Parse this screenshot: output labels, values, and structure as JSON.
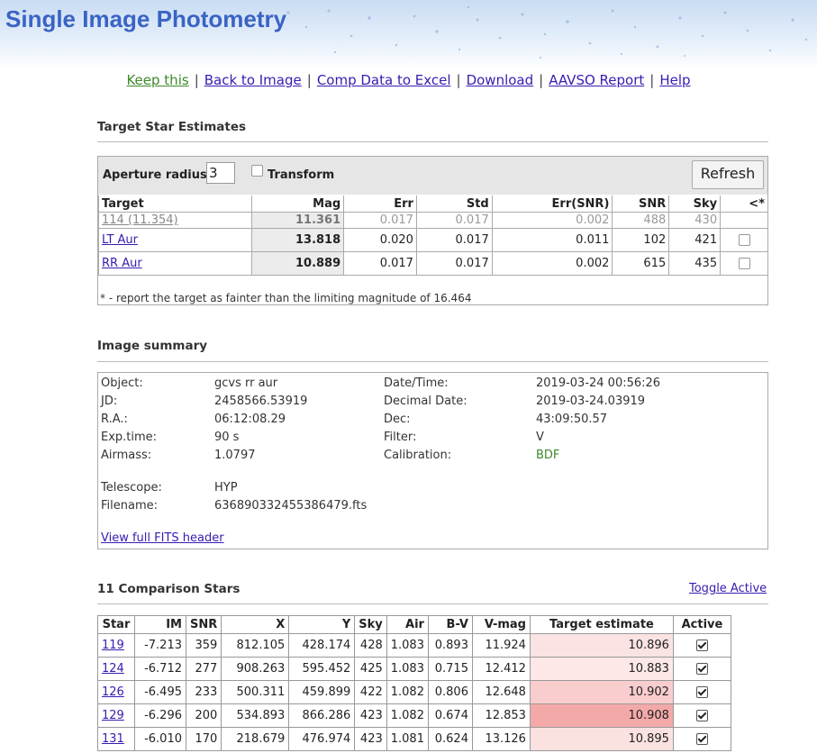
{
  "app": {
    "title": "Single Image Photometry"
  },
  "nav": [
    {
      "label": "Keep this"
    },
    {
      "label": "Back to Image"
    },
    {
      "label": "Comp Data to Excel"
    },
    {
      "label": "Download"
    },
    {
      "label": "AAVSO Report"
    },
    {
      "label": "Help"
    }
  ],
  "target_section": {
    "title": "Target Star Estimates",
    "aperture_label": "Aperture radius:",
    "aperture_value": "3",
    "transform_label": "Transform",
    "transform_checked": false,
    "refresh_label": "Refresh",
    "columns": [
      "Target",
      "Mag",
      "Err",
      "Std",
      "Err(SNR)",
      "SNR",
      "Sky",
      "<*"
    ],
    "rows": [
      {
        "target": "114 (11.354)",
        "mag": "11.361",
        "err": "0.017",
        "std": "0.017",
        "err_snr": "0.002",
        "snr": "488",
        "sky": "430"
      },
      {
        "target": "LT Aur",
        "mag": "13.818",
        "err": "0.020",
        "std": "0.017",
        "err_snr": "0.011",
        "snr": "102",
        "sky": "421"
      },
      {
        "target": "RR Aur",
        "mag": "10.889",
        "err": "0.017",
        "std": "0.017",
        "err_snr": "0.002",
        "snr": "615",
        "sky": "435"
      }
    ],
    "footnote": "* - report the target as fainter than the limiting magnitude of 16.464"
  },
  "summary": {
    "title": "Image summary",
    "object_label": "Object:",
    "object": "gcvs rr aur",
    "jd_label": "JD:",
    "jd": "2458566.53919",
    "ra_label": "R.A.:",
    "ra": "06:12:08.29",
    "exptime_label": "Exp.time:",
    "exptime": "90 s",
    "airmass_label": "Airmass:",
    "airmass": "1.0797",
    "datetime_label": "Date/Time:",
    "datetime": "2019-03-24 00:56:26",
    "decimal_label": "Decimal Date:",
    "decimal": "2019-03-24.03919",
    "dec_label": "Dec:",
    "dec": "43:09:50.57",
    "filter_label": "Filter:",
    "filter": "V",
    "calibration_label": "Calibration:",
    "calibration": "BDF",
    "telescope_label": "Telescope:",
    "telescope": "HYP",
    "filename_label": "Filename:",
    "filename": "636890332455386479.fts",
    "fits_link": "View full FITS header"
  },
  "comparison": {
    "title": "11 Comparison Stars",
    "toggle_label": "Toggle Active",
    "columns": [
      "Star",
      "IM",
      "SNR",
      "X",
      "Y",
      "Sky",
      "Air",
      "B-V",
      "V-mag",
      "Target estimate",
      "Active"
    ],
    "rows": [
      {
        "star": "119",
        "im": "-7.213",
        "snr": "359",
        "x": "812.105",
        "y": "428.174",
        "sky": "428",
        "air": "1.083",
        "bv": "0.893",
        "vmag": "11.924",
        "est": "10.896",
        "shade": "#fce3e3",
        "active": true
      },
      {
        "star": "124",
        "im": "-6.712",
        "snr": "277",
        "x": "908.263",
        "y": "595.452",
        "sky": "425",
        "air": "1.083",
        "bv": "0.715",
        "vmag": "12.412",
        "est": "10.883",
        "shade": "#fde7e7",
        "active": true
      },
      {
        "star": "126",
        "im": "-6.495",
        "snr": "233",
        "x": "500.311",
        "y": "459.899",
        "sky": "422",
        "air": "1.082",
        "bv": "0.806",
        "vmag": "12.648",
        "est": "10.902",
        "shade": "#f9cdcd",
        "active": true
      },
      {
        "star": "129",
        "im": "-6.296",
        "snr": "200",
        "x": "534.893",
        "y": "866.286",
        "sky": "423",
        "air": "1.082",
        "bv": "0.674",
        "vmag": "12.853",
        "est": "10.908",
        "shade": "#f4a9a9",
        "active": true
      },
      {
        "star": "131",
        "im": "-6.010",
        "snr": "170",
        "x": "218.679",
        "y": "476.974",
        "sky": "423",
        "air": "1.081",
        "bv": "0.624",
        "vmag": "13.126",
        "est": "10.895",
        "shade": "#fce1e1",
        "active": true
      }
    ]
  }
}
